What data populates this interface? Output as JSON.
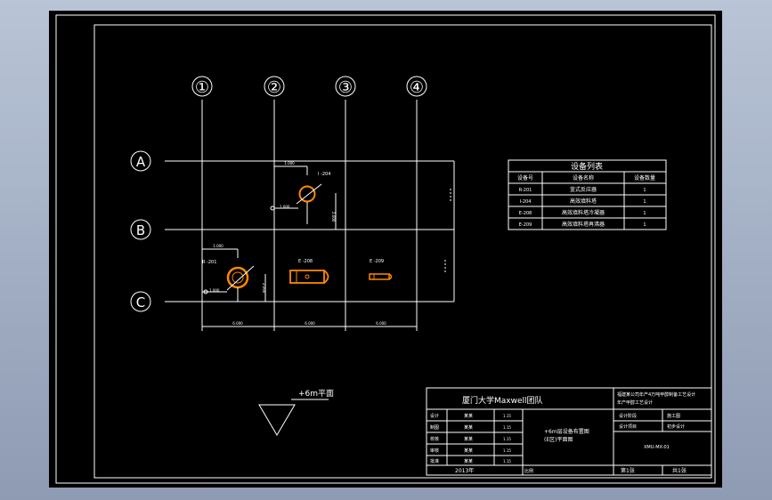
{
  "drawing": {
    "axis_cols": [
      "①",
      "②",
      "③",
      "④"
    ],
    "axis_rows": [
      "A",
      "B",
      "C"
    ],
    "equipment_labels": {
      "E201": "R -201",
      "E204": "I -204",
      "E208": "E -208",
      "E209": "E -209"
    },
    "dims": {
      "top_offset": "1.000",
      "left_offset": "1.000",
      "bottom_span": "6.000",
      "bottom_span2": "6.000",
      "bottom_span3": "6.000",
      "mark_a": "2.000",
      "mark_b": "2.000"
    },
    "plan_label": "+6m平面"
  },
  "equipment_table": {
    "title": "设备列表",
    "headers": [
      "设备号",
      "设备名称",
      "设备数量"
    ],
    "rows": [
      [
        "R-201",
        "釜式反应器",
        "1"
      ],
      [
        "I-204",
        "高效填料塔",
        "1"
      ],
      [
        "E-208",
        "高效填料塔冷凝器",
        "1"
      ],
      [
        "E-209",
        "高效填料塔再沸器",
        "1"
      ]
    ]
  },
  "title_block": {
    "team": "厦门大学Maxwell团队",
    "project": "福建某公司年产4万吨甲醇制备工艺设计",
    "subtitle": "年产甲醇工艺设计",
    "roles": [
      "设计",
      "制图",
      "校核",
      "审核",
      "批准"
    ],
    "names": [
      "某某",
      "某某",
      "某某",
      "某某",
      "某某"
    ],
    "dates": [
      "1.15",
      "1.15",
      "1.15",
      "1.15",
      "1.15"
    ],
    "drawing_name": "+6m层设备布置图",
    "drawing_sub": "(E区)平面图",
    "year": "2013年",
    "scale_label": "比例",
    "stage": "设计阶段",
    "stage_value": "施工图",
    "spec": "设计项目",
    "spec_value": "初步设计",
    "drawing_no": "XMU-MX-01",
    "sheet": "第1张",
    "total": "共1张"
  }
}
